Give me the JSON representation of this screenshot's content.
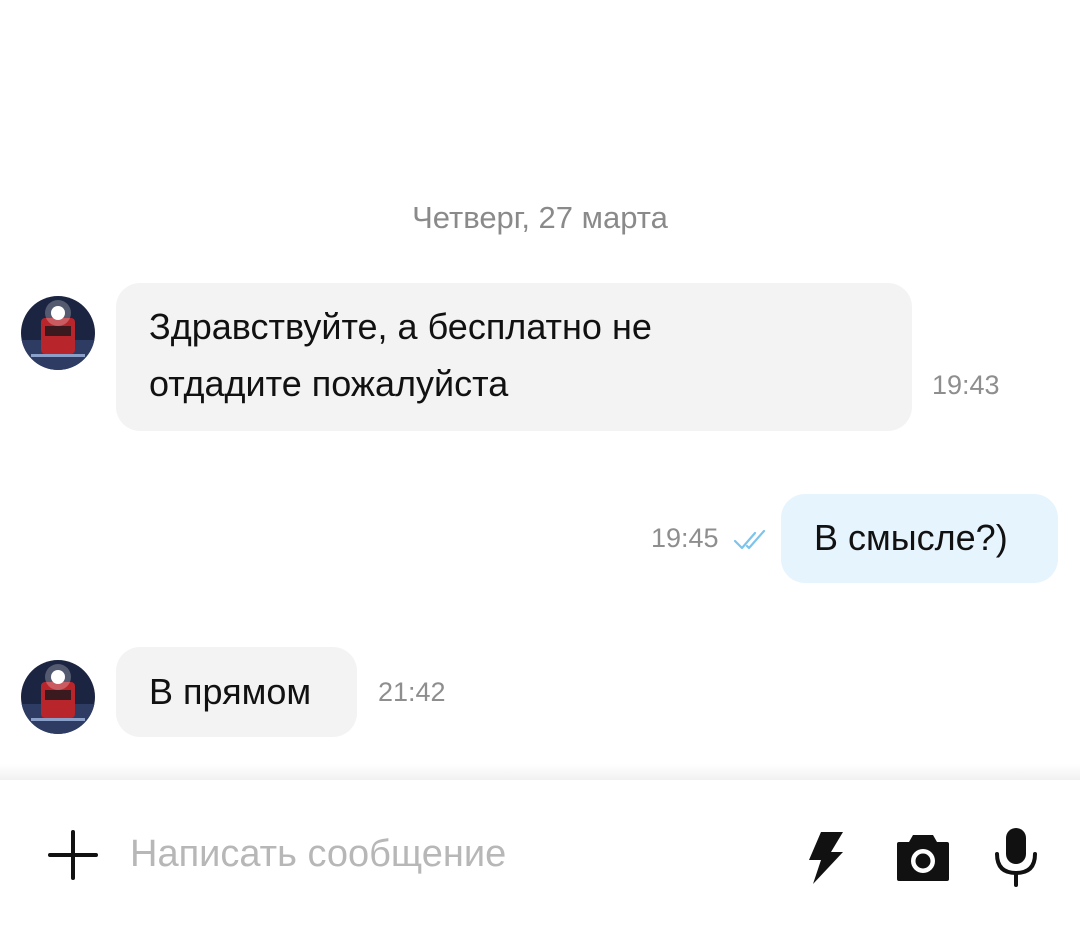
{
  "chat": {
    "date_separator": "Четверг, 27 марта",
    "messages": [
      {
        "direction": "incoming",
        "lines": [
          "Здравствуйте, а бесплатно не",
          "отдадите пожалуйста"
        ],
        "time": "19:43"
      },
      {
        "direction": "outgoing",
        "lines": [
          "В смысле?)"
        ],
        "time": "19:45",
        "status": "read"
      },
      {
        "direction": "incoming",
        "lines": [
          "В прямом"
        ],
        "time": "21:42"
      }
    ]
  },
  "composer": {
    "placeholder": "Написать сообщение",
    "icons": [
      "plus-icon",
      "lightning-icon",
      "camera-icon",
      "microphone-icon"
    ]
  },
  "colors": {
    "incoming_bubble": "#f3f3f3",
    "outgoing_bubble": "#e6f4fd",
    "read_check": "#7cc4ec",
    "secondary_text": "#8e8e8e",
    "placeholder": "#b7b7b7"
  }
}
